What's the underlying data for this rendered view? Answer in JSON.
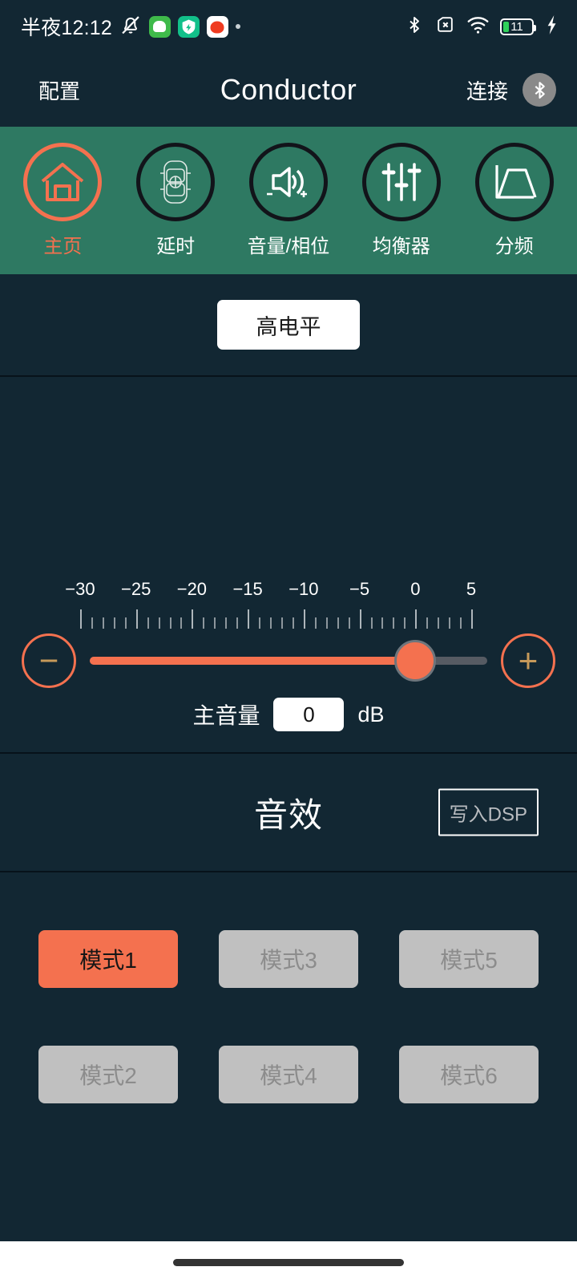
{
  "status_bar": {
    "time": "半夜12:12",
    "icons_left": [
      "silent-bell-icon",
      "app-android-icon",
      "app-shield-icon",
      "app-alert-icon",
      "more-dot-icon"
    ],
    "icons_right": [
      "bluetooth-icon",
      "no-sim-icon",
      "wifi-icon",
      "battery-icon",
      "charging-bolt-icon"
    ],
    "battery_level": "11"
  },
  "header": {
    "left_label": "配置",
    "title": "Conductor",
    "right_label": "连接",
    "bluetooth_icon": "bluetooth-icon"
  },
  "nav": {
    "tabs": [
      {
        "label": "主页",
        "icon": "home-icon",
        "active": true
      },
      {
        "label": "延时",
        "icon": "car-delay-icon",
        "active": false
      },
      {
        "label": "音量/相位",
        "icon": "speaker-icon",
        "active": false
      },
      {
        "label": "均衡器",
        "icon": "equalizer-icon",
        "active": false
      },
      {
        "label": "分频",
        "icon": "crossover-icon",
        "active": false
      }
    ]
  },
  "source": {
    "button_label": "高电平"
  },
  "volume": {
    "label": "主音量",
    "value": "0",
    "unit": "dB",
    "minus_label": "−",
    "plus_label": "+",
    "scale_ticks": [
      "−30",
      "−25",
      "−20",
      "−15",
      "−10",
      "−5",
      "0",
      "5"
    ],
    "min": -31,
    "max": 6,
    "current": 0
  },
  "effects": {
    "title": "音效",
    "write_dsp_label": "写入DSP",
    "modes": [
      {
        "label": "模式1",
        "active": true
      },
      {
        "label": "模式3",
        "active": false
      },
      {
        "label": "模式5",
        "active": false
      },
      {
        "label": "模式2",
        "active": false
      },
      {
        "label": "模式4",
        "active": false
      },
      {
        "label": "模式6",
        "active": false
      }
    ]
  },
  "colors": {
    "background": "#122733",
    "nav_green": "#2e7962",
    "accent_coral": "#f4714f",
    "inactive_grey": "#c0c0c0",
    "gold": "#c79a5a"
  }
}
